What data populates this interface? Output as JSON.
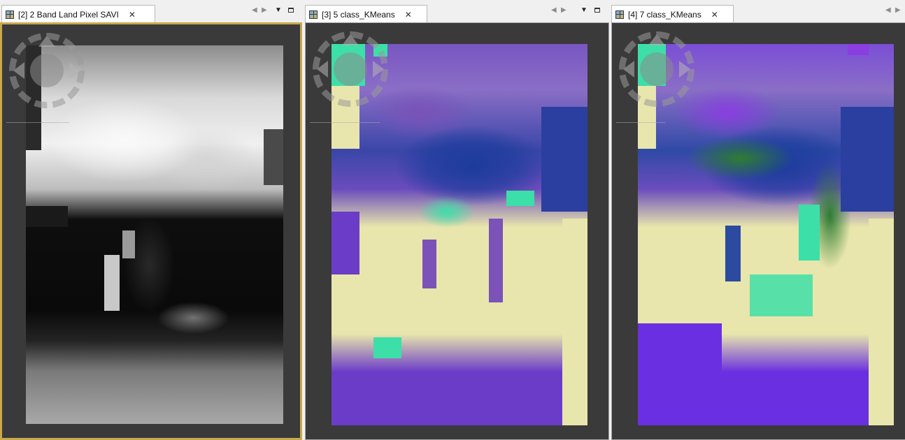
{
  "panes": [
    {
      "tab_label": "[2] 2 Band Land Pixel SAVI",
      "close_glyph": "✕",
      "selected": true
    },
    {
      "tab_label": "[3] 5 class_KMeans",
      "close_glyph": "✕",
      "selected": false
    },
    {
      "tab_label": "[4] 7 class_KMeans",
      "close_glyph": "✕",
      "selected": false
    }
  ],
  "controls": {
    "prev_glyph": "◀",
    "next_glyph": "▶",
    "menu_glyph": "▼"
  },
  "icons": {
    "tab_icon": "raster-image-icon",
    "navigation": "pan-navigation-control-icon"
  },
  "colors": {
    "view_background": "#3a3a3a",
    "selected_border": "#c9a84e",
    "class_cream": "#e8e6ac",
    "class_purple": "#6b3cc8",
    "class_lavender": "#a58fc6",
    "class_blue": "#1b3c9c",
    "class_teal": "#3ddfa8",
    "class_green": "#2e7d32",
    "class_violet": "#8a3ee0"
  }
}
